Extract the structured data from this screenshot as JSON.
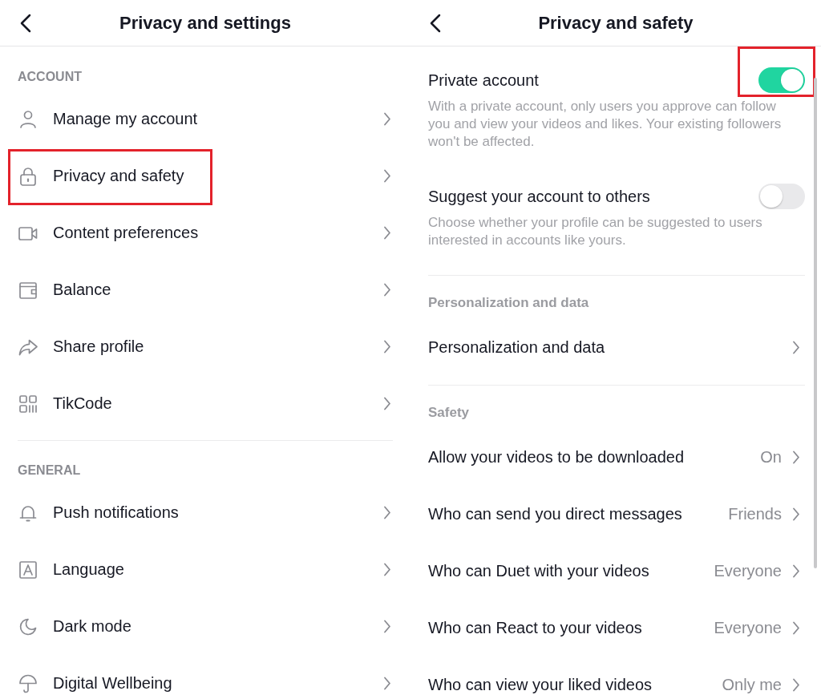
{
  "settings_menu": {
    "title": "Privacy and settings",
    "sections": [
      {
        "heading": "ACCOUNT",
        "items": [
          {
            "label": "Manage my account",
            "highlighted": false
          },
          {
            "label": "Privacy and safety",
            "highlighted": true
          },
          {
            "label": "Content preferences",
            "highlighted": false
          },
          {
            "label": "Balance",
            "highlighted": false
          },
          {
            "label": "Share profile",
            "highlighted": false
          },
          {
            "label": "TikCode",
            "highlighted": false
          }
        ]
      },
      {
        "heading": "GENERAL",
        "items": [
          {
            "label": "Push notifications",
            "highlighted": false
          },
          {
            "label": "Language",
            "highlighted": false
          },
          {
            "label": "Dark mode",
            "highlighted": false
          },
          {
            "label": "Digital Wellbeing",
            "highlighted": false
          }
        ]
      }
    ]
  },
  "privacy_screen": {
    "title": "Privacy and safety",
    "toggles": [
      {
        "label": "Private account",
        "description": "With a private account, only users you approve can follow you and view your videos and likes. Your existing followers won't be affected.",
        "on": true,
        "highlighted": true
      },
      {
        "label": "Suggest your account to others",
        "description": "Choose whether your profile can be suggested to users interested in accounts like yours.",
        "on": false,
        "highlighted": false
      }
    ],
    "sections": [
      {
        "heading": "Personalization and data",
        "items": [
          {
            "label": "Personalization and data"
          }
        ]
      },
      {
        "heading": "Safety",
        "items": [
          {
            "label": "Allow your videos to be downloaded",
            "value": "On"
          },
          {
            "label": "Who can send you direct messages",
            "value": "Friends"
          },
          {
            "label": "Who can Duet with your videos",
            "value": "Everyone"
          },
          {
            "label": "Who can React to your videos",
            "value": "Everyone"
          },
          {
            "label": "Who can view your liked videos",
            "value": "Only me"
          }
        ]
      }
    ]
  }
}
